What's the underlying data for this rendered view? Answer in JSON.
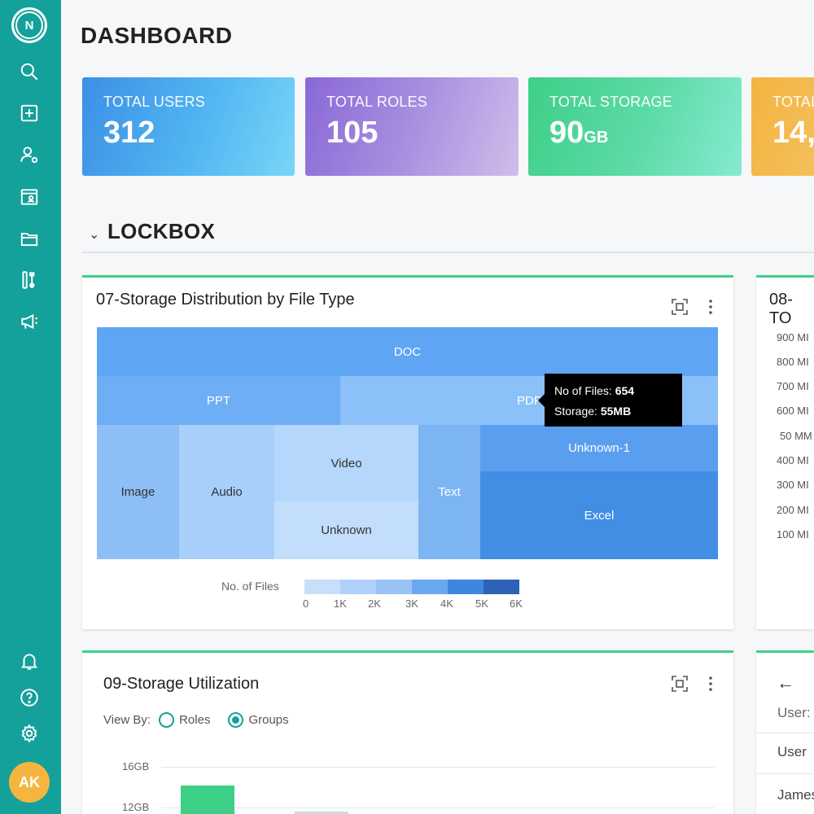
{
  "sidebar": {
    "logo_letter": "N",
    "items": [
      {
        "icon": "search-icon"
      },
      {
        "icon": "add-square-icon"
      },
      {
        "icon": "user-settings-icon"
      },
      {
        "icon": "id-card-icon"
      },
      {
        "icon": "folder-icon"
      },
      {
        "icon": "tools-icon"
      },
      {
        "icon": "megaphone-icon"
      }
    ],
    "bottom_items": [
      {
        "icon": "bell-icon"
      },
      {
        "icon": "help-icon"
      },
      {
        "icon": "settings-icon"
      }
    ],
    "avatar_initials": "AK"
  },
  "header": {
    "title": "DASHBOARD"
  },
  "stats": [
    {
      "label": "TOTAL USERS",
      "value": "312",
      "unit": ""
    },
    {
      "label": "TOTAL ROLES",
      "value": "105",
      "unit": ""
    },
    {
      "label": "TOTAL STORAGE",
      "value": "90",
      "unit": "GB"
    },
    {
      "label": "TOTAL",
      "value": "14,",
      "unit": ""
    }
  ],
  "section": {
    "title": "LOCKBOX"
  },
  "panel07": {
    "title": "07-Storage Distribution by File Type",
    "tooltip": {
      "files_label": "No of Files:",
      "files_value": "654",
      "storage_label": "Storage:",
      "storage_value": "55MB"
    },
    "legend": {
      "label": "No. of Files",
      "ticks": [
        "0",
        "1K",
        "2K",
        "3K",
        "4K",
        "5K",
        "6K"
      ],
      "colors": [
        "#c6dffb",
        "#b0d2fa",
        "#99c3f7",
        "#6aa8f1",
        "#3f86e0",
        "#2d63b6"
      ]
    }
  },
  "chart_data": {
    "type": "treemap",
    "title": "07-Storage Distribution by File Type",
    "color_legend": "No. of Files",
    "color_range": [
      0,
      6000
    ],
    "items": [
      {
        "name": "DOC",
        "color": "#5ea5f4"
      },
      {
        "name": "PPT",
        "color": "#6eaef5"
      },
      {
        "name": "PDF",
        "color": "#8cc0f8",
        "files": 654,
        "storage": "55MB"
      },
      {
        "name": "Image",
        "color": "#8ebef6"
      },
      {
        "name": "Audio",
        "color": "#a8cff9"
      },
      {
        "name": "Video",
        "color": "#b5d7fb"
      },
      {
        "name": "Unknown",
        "color": "#c3defc"
      },
      {
        "name": "Text",
        "color": "#7db5f3"
      },
      {
        "name": "Unknown-1",
        "color": "#5a9ef0"
      },
      {
        "name": "Excel",
        "color": "#428ee5"
      }
    ]
  },
  "panel08": {
    "title": "08-TO",
    "axis_ticks": [
      "900 MI",
      "800 MI",
      "700 MI",
      "600 MI",
      "50 MM",
      "400 MI",
      "300 MI",
      "200 MI",
      "100 MI"
    ]
  },
  "panel09": {
    "title": "09-Storage Utilization",
    "view_by_label": "View By:",
    "options": [
      {
        "label": "Roles",
        "selected": false
      },
      {
        "label": "Groups",
        "selected": true
      }
    ],
    "y_ticks": [
      "16GB",
      "12GB"
    ]
  },
  "panel10": {
    "user_label": "User:",
    "column_header": "User",
    "first_row": "James"
  }
}
